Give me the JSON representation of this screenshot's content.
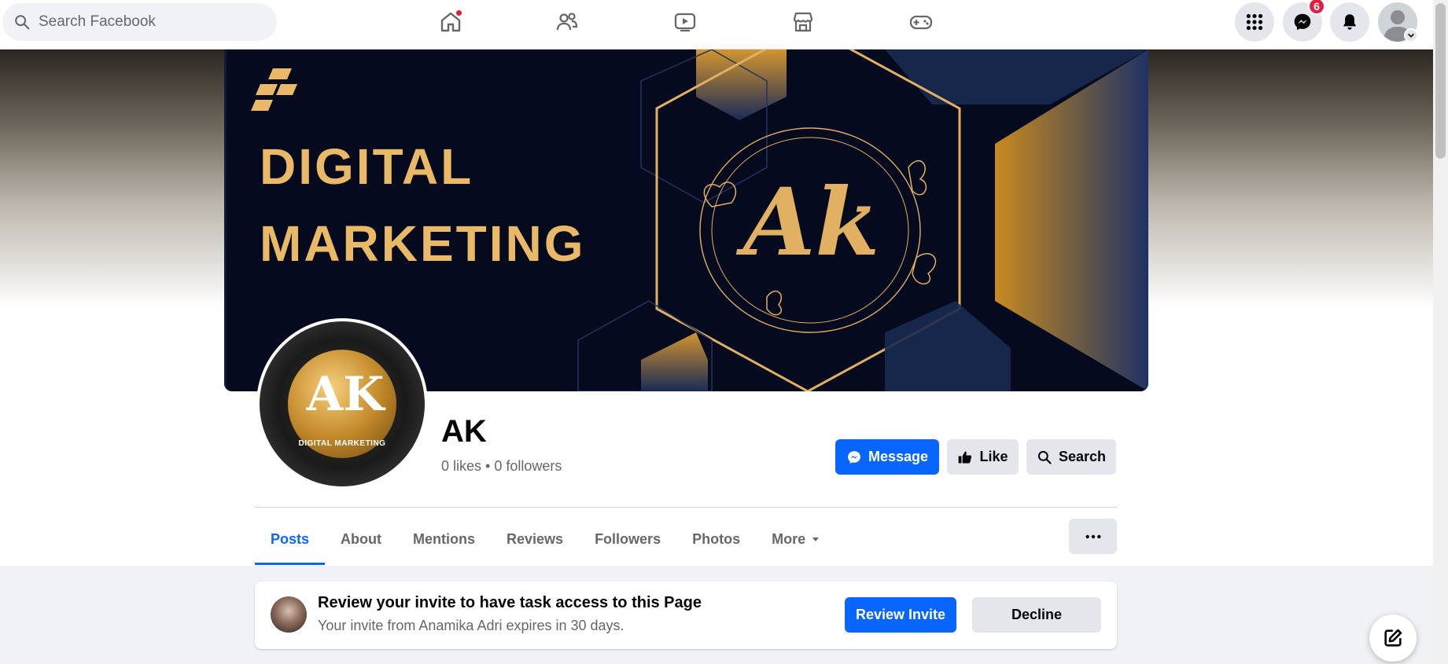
{
  "topbar": {
    "search_placeholder": "Search Facebook",
    "messenger_badge": "6",
    "nav_icons": [
      "home-icon",
      "friends-icon",
      "video-icon",
      "marketplace-icon",
      "gaming-icon"
    ]
  },
  "cover": {
    "headline_line1": "DIGITAL",
    "headline_line2": "MARKETING",
    "monogram": "Ak"
  },
  "profile": {
    "avatar_monogram": "AK",
    "avatar_caption": "DIGITAL MARKETING",
    "name": "AK",
    "stats": "0 likes • 0 followers"
  },
  "actions": {
    "message_label": "Message",
    "like_label": "Like",
    "search_label": "Search"
  },
  "tabs": [
    {
      "label": "Posts",
      "active": true
    },
    {
      "label": "About"
    },
    {
      "label": "Mentions"
    },
    {
      "label": "Reviews"
    },
    {
      "label": "Followers"
    },
    {
      "label": "Photos"
    },
    {
      "label": "More"
    }
  ],
  "invite": {
    "title": "Review your invite to have task access to this Page",
    "subtitle": "Your invite from Anamika Adri expires in 30 days.",
    "review_label": "Review Invite",
    "decline_label": "Decline"
  },
  "colors": {
    "accent": "#0866ff",
    "notification": "#e41e3f",
    "gold": "#e9b967",
    "navy": "#050a1e"
  }
}
